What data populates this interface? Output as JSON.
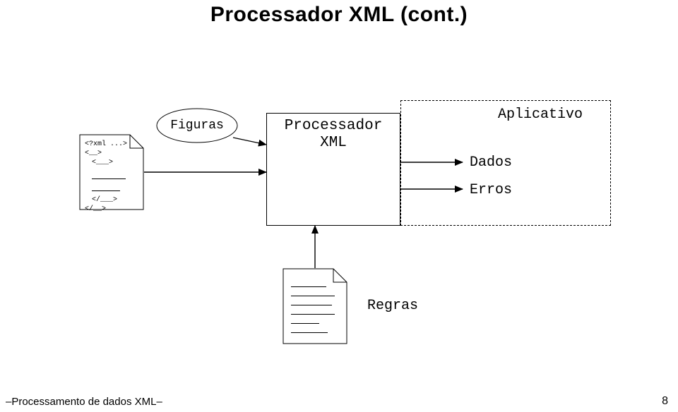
{
  "title": "Processador XML (cont.)",
  "xmlfile_lines": [
    "<?xml ...>",
    "<__>",
    "  <___>",
    "",
    "  </___>",
    "</__>"
  ],
  "figuras_label": "Figuras",
  "processor_label_line1": "Processador",
  "processor_label_line2": "XML",
  "aplicativo_label": "Aplicativo",
  "dados_label": "Dados",
  "erros_label": "Erros",
  "regras_label": "Regras",
  "footer_left": "–Processamento de dados XML–",
  "footer_right": "8"
}
